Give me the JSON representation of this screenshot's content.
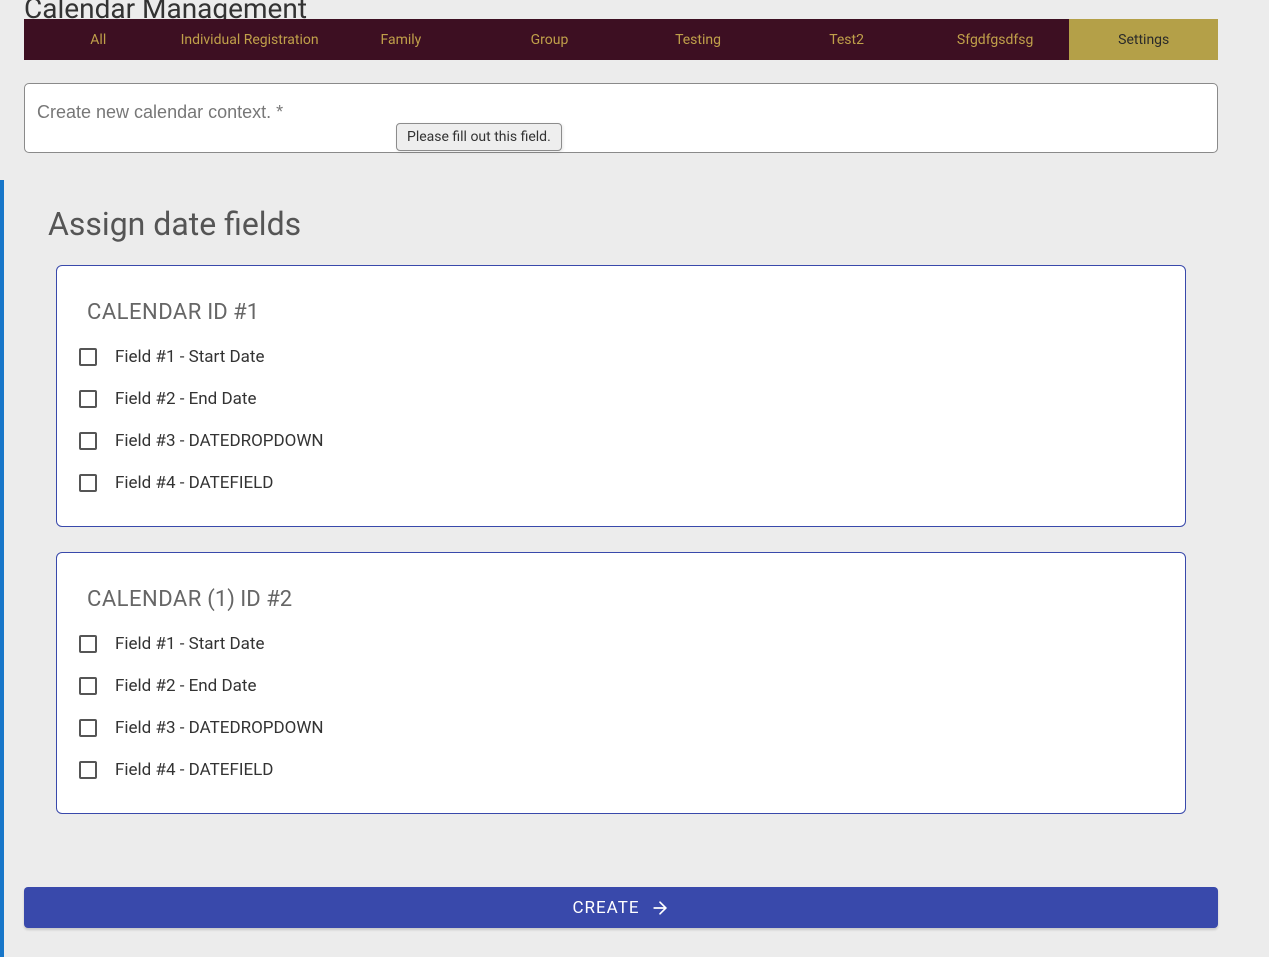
{
  "page_title": "Calendar Management",
  "tabs": [
    {
      "label": "All"
    },
    {
      "label": "Individual Registration"
    },
    {
      "label": "Family"
    },
    {
      "label": "Group"
    },
    {
      "label": "Testing"
    },
    {
      "label": "Test2"
    },
    {
      "label": "Sfgdfgsdfsg"
    },
    {
      "label": "Settings",
      "active": true
    }
  ],
  "context_input": {
    "placeholder": "Create new calendar context. *",
    "value": ""
  },
  "validation_tooltip": "Please fill out this field.",
  "section_heading": "Assign date fields",
  "calendars": [
    {
      "title_prefix": "CALENDAR",
      "title_suffix": " ID #1",
      "fields": [
        "Field #1 - Start Date",
        "Field #2 - End Date",
        "Field #3 - DATEDROPDOWN",
        "Field #4 - DATEFIELD"
      ]
    },
    {
      "title_prefix": "CALENDAR",
      "title_suffix": " (1) ID #2",
      "fields": [
        "Field #1 - Start Date",
        "Field #2 - End Date",
        "Field #3 - DATEDROPDOWN",
        "Field #4 - DATEFIELD"
      ]
    }
  ],
  "create_button_label": "CREATE"
}
